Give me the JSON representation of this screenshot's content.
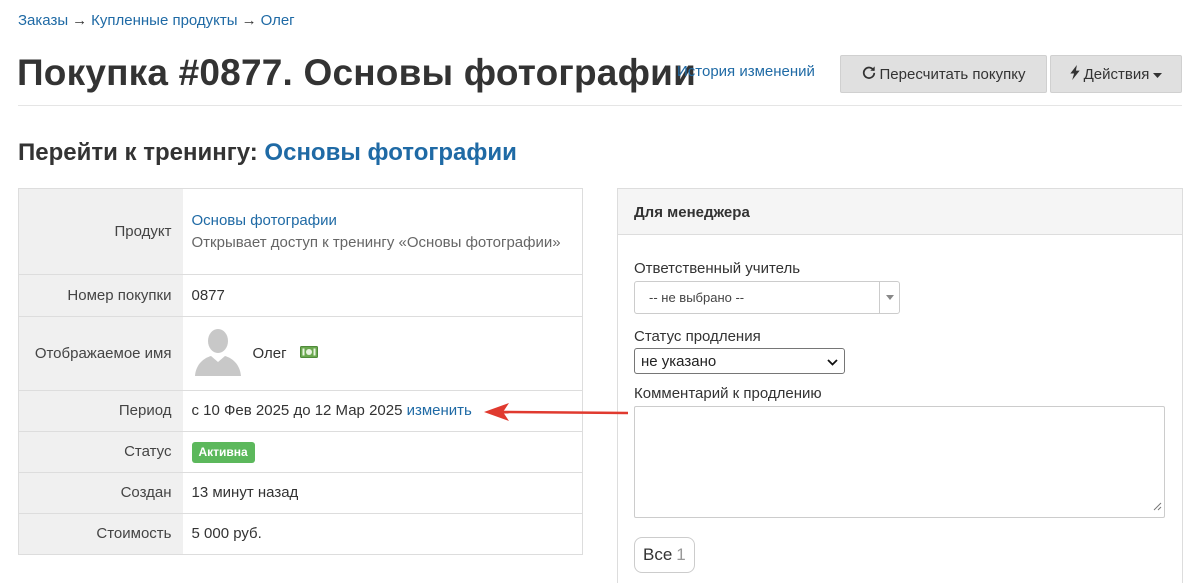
{
  "breadcrumb": {
    "items": [
      "Заказы",
      "Купленные продукты",
      "Олег"
    ],
    "separator": "→"
  },
  "header": {
    "title": "Покупка #0877. Основы фотографии",
    "history_link": "История изменений",
    "recalc_button": "Пересчитать покупку",
    "actions_button": "Действия"
  },
  "training": {
    "prefix": "Перейти к тренингу:",
    "link": "Основы фотографии"
  },
  "info": {
    "product_label": "Продукт",
    "product_name": "Основы фотографии",
    "product_desc": "Открывает доступ к тренингу «Основы фотографии»",
    "number_label": "Номер покупки",
    "number_value": "0877",
    "display_name_label": "Отображаемое имя",
    "user_name": "Олег",
    "period_label": "Период",
    "period_value": "с 10 Фев 2025 до 12 Мар 2025",
    "period_change": "изменить",
    "status_label": "Статус",
    "status_value": "Активна",
    "created_label": "Создан",
    "created_value": "13 минут назад",
    "cost_label": "Стоимость",
    "cost_value": "5 000 руб."
  },
  "manager": {
    "title": "Для менеджера",
    "teacher_label": "Ответственный учитель",
    "teacher_value": "-- не выбрано --",
    "renewal_label": "Статус продления",
    "renewal_value": "не указано",
    "comment_label": "Комментарий к продлению",
    "comment_value": "",
    "all_button": "Все",
    "all_count": "1"
  },
  "colors": {
    "link": "#1f6aa5",
    "badge_active": "#5cb85c",
    "annotation_arrow": "#e03a2f"
  }
}
